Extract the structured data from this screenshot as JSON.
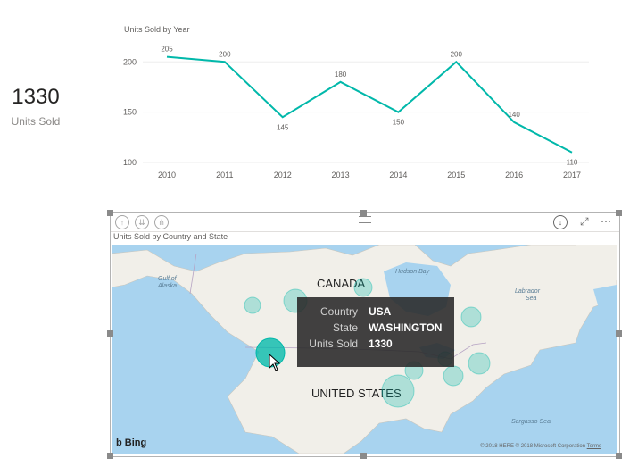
{
  "card": {
    "value": "1330",
    "label": "Units Sold"
  },
  "line_chart_title": "Units Sold by Year",
  "chart_data": {
    "type": "line",
    "title": "Units Sold by Year",
    "x": [
      "2010",
      "2011",
      "2012",
      "2013",
      "2014",
      "2015",
      "2016",
      "2017"
    ],
    "series": [
      {
        "values": [
          205,
          200,
          145,
          180,
          150,
          200,
          140,
          110
        ]
      }
    ],
    "yticks": [
      "200",
      "150",
      "100"
    ],
    "ylim": [
      100,
      210
    ],
    "grid": true,
    "line_color": "#01B8AA"
  },
  "map": {
    "title": "Units Sold by Country and State",
    "header_icons": [
      "drill-up-icon",
      "drill-down-all-icon",
      "expand-hierarchy-icon",
      "drill-mode-icon",
      "focus-mode-icon",
      "more-options-icon"
    ],
    "labels": {
      "canada": "CANADA",
      "usa": "UNITED STATES",
      "hudson_bay": "Hudson Bay",
      "gulf_alaska": "Gulf of\nAlaska",
      "labrador": "Labrador\nSea",
      "sargasso": "Sargasso Sea"
    },
    "bing": "Bing",
    "copyright": "© 2018 HERE © 2018 Microsoft Corporation",
    "terms": "Terms",
    "bubble_color": "#01B8AA"
  },
  "tooltip": {
    "rows": [
      {
        "key": "Country",
        "value": "USA"
      },
      {
        "key": "State",
        "value": "WASHINGTON"
      },
      {
        "key": "Units Sold",
        "value": "1330"
      }
    ]
  }
}
